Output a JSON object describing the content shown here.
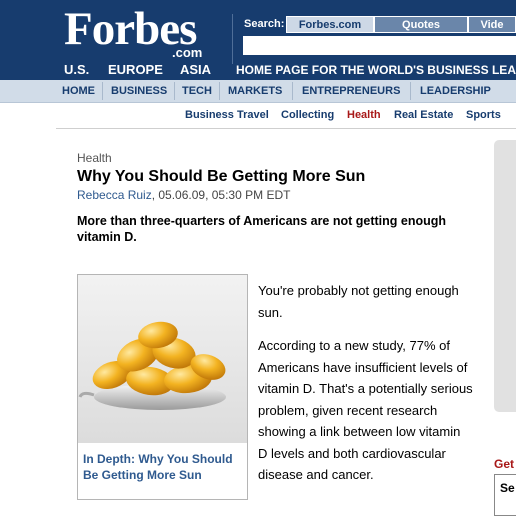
{
  "header": {
    "logo_text": "Forbes",
    "logo_suffix": ".com",
    "regions": [
      "U.S.",
      "EUROPE",
      "ASIA"
    ],
    "search_label": "Search:",
    "search_tabs": [
      "Forbes.com",
      "Quotes",
      "Vide"
    ],
    "search_value": "",
    "tagline": "HOME PAGE FOR THE WORLD'S BUSINESS LEA"
  },
  "nav": {
    "items": [
      "HOME",
      "BUSINESS",
      "TECH",
      "MARKETS",
      "ENTREPRENEURS",
      "LEADERSHIP"
    ]
  },
  "subnav": {
    "items": [
      "Business Travel",
      "Collecting",
      "Health",
      "Real Estate",
      "Sports"
    ],
    "current": "Health"
  },
  "article": {
    "section": "Health",
    "headline": "Why You Should Be Getting More Sun",
    "author": "Rebecca Ruiz",
    "date": ", 05.06.09, 05:30 PM EDT",
    "dek": "More than three-quarters of Americans are not getting enough vitamin D.",
    "image_caption": "In Depth: Why You Should Be Getting More Sun",
    "paragraphs": [
      "You're probably not getting enough sun.",
      "According to a new study, 77% of Americans have insufficient levels of vitamin D. That's a potentially serious problem, given recent research showing a link between low vitamin D levels and both cardiovascular disease and cancer."
    ]
  },
  "rail": {
    "label_partial": "Get",
    "box_partial": "Se"
  },
  "colors": {
    "header_bg": "#173c6e",
    "nav_bg": "#d1dce8",
    "link_blue": "#2f5a8f",
    "accent_red": "#a81818"
  }
}
